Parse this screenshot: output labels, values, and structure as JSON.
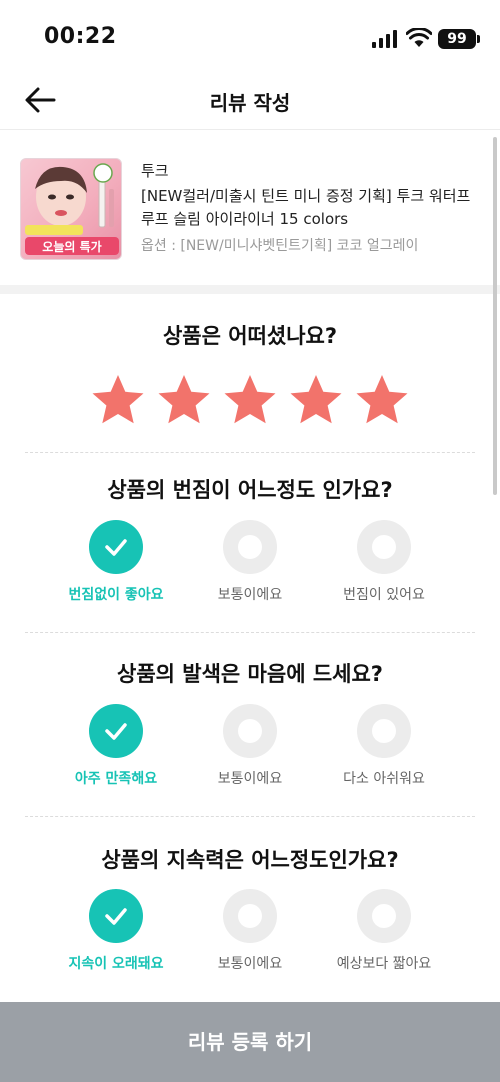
{
  "status_bar": {
    "time": "00:22",
    "battery": "99"
  },
  "header": {
    "title": "리뷰 작성"
  },
  "product": {
    "brand": "투크",
    "name": "[NEW컬러/미출시 틴트 미니 증정 기획] 투크 워터프루프 슬림 아이라이너 15 colors",
    "option": "옵션 : [NEW/미니샤벳틴트기획] 코코 얼그레이",
    "thumb_caption": "오늘의 특가"
  },
  "rating": {
    "question": "상품은 어떠셨나요?",
    "stars": 5,
    "max_stars": 5,
    "star_color": "#f2736b"
  },
  "questions": [
    {
      "question": "상품의 번짐이 어느정도 인가요?",
      "options": [
        "번짐없이 좋아요",
        "보통이에요",
        "번짐이 있어요"
      ],
      "selected": 0
    },
    {
      "question": "상품의 발색은 마음에 드세요?",
      "options": [
        "아주 만족해요",
        "보통이에요",
        "다소 아쉬워요"
      ],
      "selected": 0
    },
    {
      "question": "상품의 지속력은 어느정도인가요?",
      "options": [
        "지속이 오래돼요",
        "보통이에요",
        "예상보다 짧아요"
      ],
      "selected": 0
    }
  ],
  "submit": {
    "label": "리뷰 등록 하기"
  },
  "colors": {
    "accent": "#17c3b5",
    "button_disabled": "#9ba0a6"
  }
}
